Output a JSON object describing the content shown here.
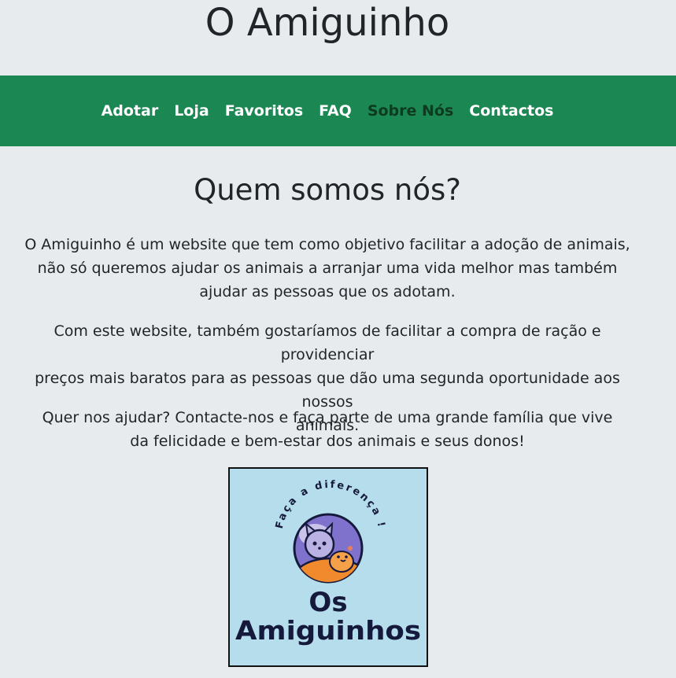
{
  "site": {
    "title": "O Amiguinho"
  },
  "nav": {
    "items": [
      {
        "label": "Adotar"
      },
      {
        "label": "Loja"
      },
      {
        "label": "Favoritos"
      },
      {
        "label": "FAQ"
      },
      {
        "label": "Sobre Nós",
        "active": true
      },
      {
        "label": "Contactos"
      }
    ],
    "active_color": "#0e3a1f"
  },
  "main": {
    "heading": "Quem somos nós?",
    "paragraphs": [
      {
        "lines": [
          "O Amiguinho é um website que tem como objetivo facilitar a adoção de animais,",
          "não só queremos ajudar os animais a arranjar uma vida melhor mas também",
          "ajudar as pessoas que os adotam."
        ]
      },
      {
        "lines": [
          "Com este website, também gostaríamos de facilitar a compra de ração e providenciar",
          "preços mais baratos para as pessoas que dão uma segunda oportunidade aos nossos",
          "animais."
        ]
      },
      {
        "lines": [
          "Quer nos ajudar? Contacte-nos e faça parte de uma grande família que vive",
          "da felicidade e bem-estar dos animais e seus donos!"
        ]
      }
    ]
  },
  "logo": {
    "arc_text": "Faça a diferença !",
    "name_line1": "Os",
    "name_line2": "Amiguinhos",
    "background": "#b6ddeb",
    "text_color": "#151a3d"
  },
  "colors": {
    "page_background": "#e8ebee",
    "navbar": "#1b8753",
    "text": "#212529"
  }
}
